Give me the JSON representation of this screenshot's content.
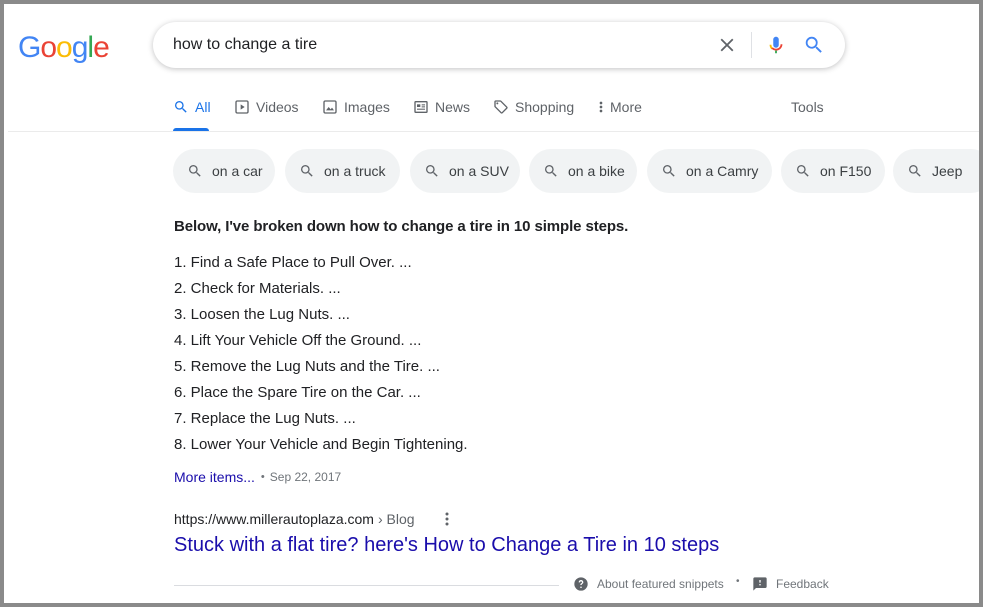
{
  "logo": {
    "text": "Google",
    "letters": [
      "G",
      "o",
      "o",
      "g",
      "l",
      "e"
    ],
    "colors": [
      "#4285F4",
      "#EA4335",
      "#FBBC05",
      "#4285F4",
      "#34A853",
      "#EA4335"
    ]
  },
  "search": {
    "query": "how to change a tire",
    "icons": [
      "close-icon",
      "mic-icon",
      "search-icon"
    ]
  },
  "tabs": [
    {
      "label": "All",
      "icon": "search-icon",
      "active": true
    },
    {
      "label": "Videos",
      "icon": "play-icon"
    },
    {
      "label": "Images",
      "icon": "image-icon"
    },
    {
      "label": "News",
      "icon": "news-icon"
    },
    {
      "label": "Shopping",
      "icon": "tag-icon"
    },
    {
      "label": "More",
      "icon": "more-vert-icon"
    }
  ],
  "tools_label": "Tools",
  "chips": [
    "on a car",
    "on a truck",
    "on a SUV",
    "on a bike",
    "on a Camry",
    "on F150",
    "Jeep"
  ],
  "snippet": {
    "heading": "Below, I've broken down how to change a tire in 10 simple steps.",
    "steps": [
      "1. Find a Safe Place to Pull Over. ...",
      "2. Check for Materials. ...",
      "3. Loosen the Lug Nuts. ...",
      "4. Lift Your Vehicle Off the Ground. ...",
      "5. Remove the Lug Nuts and the Tire. ...",
      "6. Place the Spare Tire on the Car. ...",
      "7. Replace the Lug Nuts. ...",
      "8. Lower Your Vehicle and Begin Tightening."
    ],
    "more_items": "More items...",
    "separator": "•",
    "date": "Sep 22, 2017"
  },
  "result": {
    "url": "https://www.millerautoplaza.com",
    "path": "› Blog",
    "title": "Stuck with a flat tire? here's How to Change a Tire in 10 steps"
  },
  "footer": {
    "about": "About featured snippets",
    "separator": "•",
    "feedback": "Feedback"
  },
  "colors": {
    "link": "#1a0dab",
    "accent": "#1a73e8",
    "chip_bg": "#f1f3f4",
    "muted": "#70757a"
  }
}
